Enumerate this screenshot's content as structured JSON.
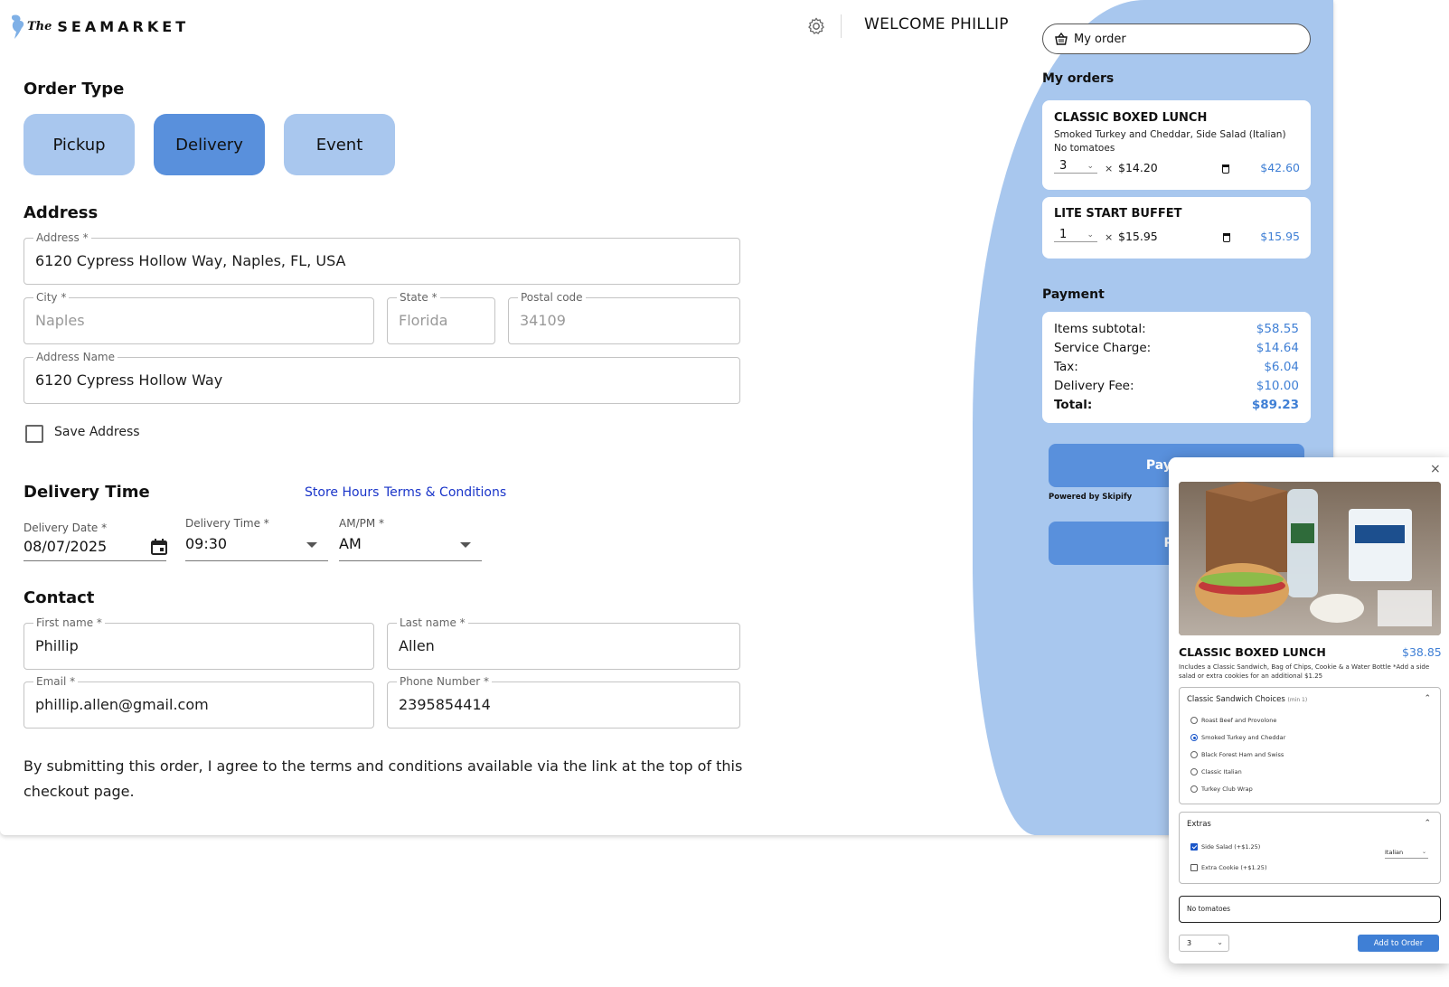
{
  "header": {
    "brand": "SEAMARKET",
    "brand_prefix": "The",
    "welcome": "WELCOME PHILLIP"
  },
  "order_type": {
    "heading": "Order Type",
    "options": [
      "Pickup",
      "Delivery",
      "Event"
    ],
    "selected": "Delivery"
  },
  "address": {
    "heading": "Address",
    "address_label": "Address *",
    "address_value": "6120 Cypress Hollow Way, Naples, FL, USA",
    "city_label": "City *",
    "city_value": "Naples",
    "state_label": "State *",
    "state_value": "Florida",
    "postal_label": "Postal code",
    "postal_value": "34109",
    "name_label": "Address Name",
    "name_value": "6120 Cypress Hollow Way",
    "save_label": "Save Address"
  },
  "delivery_time": {
    "heading": "Delivery Time",
    "store_hours_link": "Store Hours",
    "terms_link": "Terms & Conditions",
    "date_label": "Delivery Date *",
    "date_value": "08/07/2025",
    "time_label": "Delivery Time *",
    "time_value": "09:30",
    "ampm_label": "AM/PM *",
    "ampm_value": "AM"
  },
  "contact": {
    "heading": "Contact",
    "first_label": "First name *",
    "first_value": "Phillip",
    "last_label": "Last name *",
    "last_value": "Allen",
    "email_label": "Email *",
    "email_value": "phillip.allen@gmail.com",
    "phone_label": "Phone Number *",
    "phone_value": "2395854414"
  },
  "terms_text": "By submitting this order, I agree to the terms and conditions available via the link at the top of this checkout page.",
  "cart": {
    "my_order_button": "My order",
    "orders_heading": "My orders",
    "items": [
      {
        "title": "CLASSIC BOXED LUNCH",
        "details": "Smoked Turkey and Cheddar, Side Salad (Italian)",
        "note": "No tomatoes",
        "qty": "3",
        "unit_price": "$14.20",
        "total": "$42.60"
      },
      {
        "title": "LITE START BUFFET",
        "details": "",
        "note": "",
        "qty": "1",
        "unit_price": "$15.95",
        "total": "$15.95"
      }
    ],
    "times_symbol": "×",
    "payment_heading": "Payment",
    "payment": [
      {
        "label": "Items subtotal:",
        "value": "$58.55"
      },
      {
        "label": "Service Charge:",
        "value": "$14.64"
      },
      {
        "label": "Tax:",
        "value": "$6.04"
      },
      {
        "label": "Delivery Fee:",
        "value": "$10.00"
      },
      {
        "label": "Total:",
        "value": "$89.23"
      }
    ],
    "pay_now_label": "Pay Now",
    "powered_by": "Powered by  Skipify",
    "pay_label": "Pay"
  },
  "modal": {
    "close": "×",
    "title": "CLASSIC BOXED LUNCH",
    "price": "$38.85",
    "description": "Includes a Classic Sandwich, Bag of Chips, Cookie & a Water Bottle *Add a side salad or extra cookies for an additional $1.25",
    "sandwich_heading": "Classic Sandwich Choices",
    "sandwich_min": "(min 1)",
    "sandwich_options": [
      "Roast Beef and Provolone",
      "Smoked Turkey and Cheddar",
      "Black Forest Ham and Swiss",
      "Classic Italian",
      "Turkey Club Wrap"
    ],
    "sandwich_selected": "Smoked Turkey and Cheddar",
    "extras_heading": "Extras",
    "extras": [
      {
        "label": "Side Salad (+$1.25)",
        "checked": true
      },
      {
        "label": "Extra Cookie (+$1.25)",
        "checked": false
      }
    ],
    "side_salad_choice": "Italian",
    "note_value": "No tomatoes",
    "qty": "3",
    "add_button": "Add to Order"
  },
  "colors": {
    "accent": "#5990dc",
    "panel": "#a8c7ee",
    "price": "#3f7fd5",
    "link": "#1a35c9"
  }
}
